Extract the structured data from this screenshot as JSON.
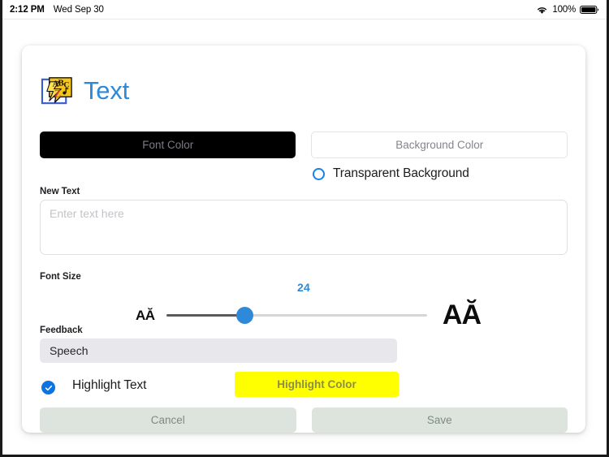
{
  "statusbar": {
    "time": "2:12 PM",
    "date": "Wed Sep 30",
    "battery_percent": "100%",
    "wifi_icon": "wifi-icon",
    "battery_icon": "battery-icon"
  },
  "header": {
    "title": "Text",
    "icon": "abc-text-app-icon",
    "title_color": "#2e8ad8"
  },
  "colors": {
    "font_color_label": "Font Color",
    "font_color_swatch": "#000000",
    "background_color_label": "Background Color",
    "background_color_swatch": "#ffffff",
    "transparent_background_label": "Transparent Background",
    "transparent_background_checked": false,
    "accent": "#2e8ad8"
  },
  "new_text": {
    "label": "New Text",
    "placeholder": "Enter text here",
    "value": ""
  },
  "font_size": {
    "label": "Font Size",
    "value": "24",
    "small_icon_glyph": "AĂ",
    "large_icon_glyph": "AĂ",
    "thumb_percent": 30
  },
  "feedback": {
    "label": "Feedback",
    "value": "Speech"
  },
  "highlight": {
    "checkbox_label": "Highlight Text",
    "checked": true,
    "color_button_label": "Highlight Color",
    "color_swatch": "#ffff00"
  },
  "footer": {
    "cancel_label": "Cancel",
    "save_label": "Save"
  }
}
